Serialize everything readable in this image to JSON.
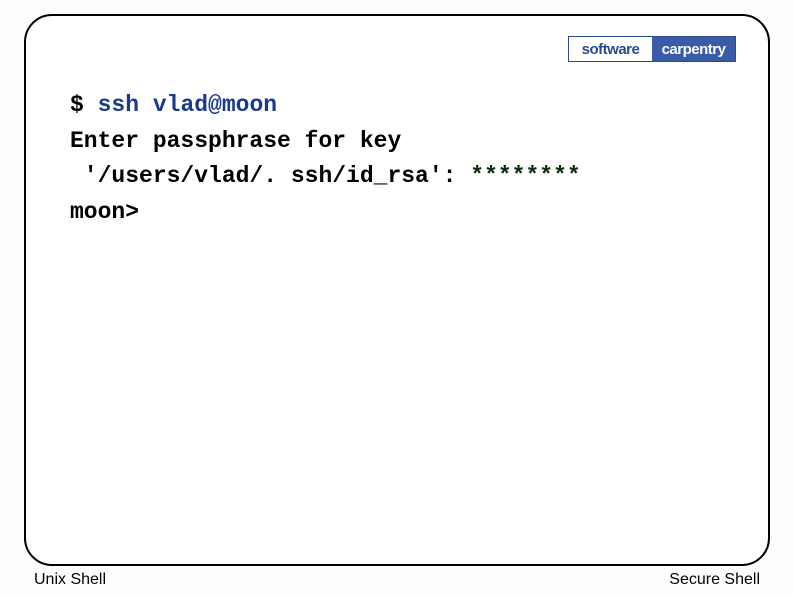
{
  "logo": {
    "left": "software",
    "right": "carpentry"
  },
  "terminal": {
    "prompt": "$",
    "command": "ssh vlad@moon",
    "response_line1": "Enter passphrase for key",
    "response_line2": " '/users/vlad/. ssh/id_rsa': ",
    "password": "********",
    "prompt2": "moon>"
  },
  "footer": {
    "left": "Unix Shell",
    "right": "Secure Shell"
  }
}
